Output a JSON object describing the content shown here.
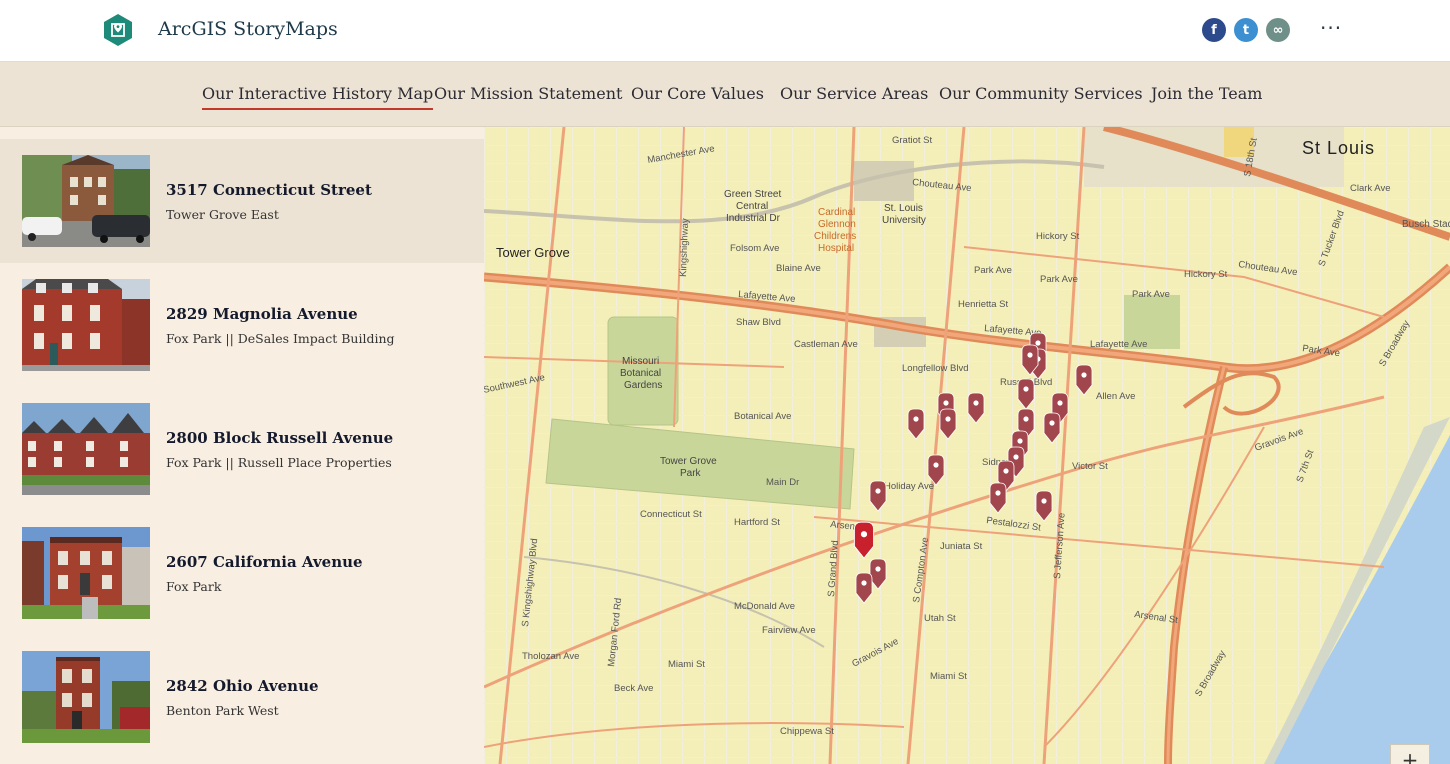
{
  "app": {
    "title": "ArcGIS StoryMaps",
    "brand_color": "#1e8a7a",
    "more_label": "···"
  },
  "share": {
    "facebook_glyph": "f",
    "twitter_glyph": "t",
    "link_glyph": "∞"
  },
  "nav": {
    "items": [
      {
        "label": "Our Interactive History Map",
        "active": true
      },
      {
        "label": "Our Mission Statement",
        "active": false
      },
      {
        "label": "Our Core Values",
        "active": false
      },
      {
        "label": "Our Service Areas",
        "active": false
      },
      {
        "label": "Our Community Services",
        "active": false
      },
      {
        "label": "Join the Team",
        "active": false
      }
    ],
    "active_color": "#c0392b"
  },
  "places": [
    {
      "title": "3517 Connecticut Street",
      "subtitle": "Tower Grove East",
      "selected": true
    },
    {
      "title": "2829 Magnolia Avenue",
      "subtitle": "Fox Park || DeSales Impact Building",
      "selected": false
    },
    {
      "title": "2800 Block Russell Avenue",
      "subtitle": "Fox Park || Russell Place Properties",
      "selected": false
    },
    {
      "title": "2607 California Avenue",
      "subtitle": "Fox Park",
      "selected": false
    },
    {
      "title": "2842 Ohio Avenue",
      "subtitle": "Benton Park West",
      "selected": false
    }
  ],
  "map": {
    "zoom_in_label": "+",
    "marker_color": "#a0464c",
    "active_marker_color": "#c8202c",
    "labels": {
      "st_louis": "St Louis",
      "tower_grove": "Tower Grove",
      "green_street_1": "Green Street",
      "green_street_2": "Central",
      "green_street_3": "Industrial Dr",
      "cardinal_1": "Cardinal",
      "cardinal_2": "Glennon",
      "cardinal_3": "Childrens",
      "cardinal_4": "Hospital",
      "slu_1": "St. Louis",
      "slu_2": "University",
      "botanical_1": "Missouri",
      "botanical_2": "Botanical",
      "botanical_3": "Gardens",
      "tower_grove_park_1": "Tower Grove",
      "tower_grove_park_2": "Park",
      "manchester": "Manchester Ave",
      "chouteau_1": "Chouteau Ave",
      "chouteau_2": "Chouteau Ave",
      "gratiot": "Gratiot St",
      "lafayette_1": "Lafayette Ave",
      "lafayette_2": "Lafayette Ave",
      "lafayette_3": "Lafayette Ave",
      "park_1": "Park Ave",
      "park_2": "Park Ave",
      "park_3": "Park Ave",
      "park_4": "Park Ave",
      "shaw": "Shaw Blvd",
      "castleman": "Castleman Ave",
      "botanical_ave": "Botanical Ave",
      "russell": "Russell Blvd",
      "allen": "Allen Ave",
      "gravois_1": "Gravois Ave",
      "gravois_2": "Gravois Ave",
      "arsenal_1": "Arsenal St",
      "arsenal_2": "Arsenal St",
      "hartford": "Hartford St",
      "connecticut": "Connecticut St",
      "juniata": "Juniata St",
      "utah": "Utah St",
      "miami_1": "Miami St",
      "miami_2": "Miami St",
      "chippewa": "Chippewa St",
      "tholoza": "Tholozan Ave",
      "mcdonald": "McDonald Ave",
      "fairview": "Fairview Ave",
      "beck": "Beck Ave",
      "s_grand": "S Grand Blvd",
      "s_compton": "S Compton Ave",
      "s_jefferson": "S Jefferson Ave",
      "s_kingshighway": "S Kingshighway Blvd",
      "s_tucker": "S Tucker Blvd",
      "s_broadway_1": "S Broadway",
      "s_broadway_2": "S Broadway",
      "s_18th": "S 18th St",
      "s_7th": "S 7th St",
      "morgan_ford": "Morgan Ford Rd",
      "kingshighway_n": "Kingshighway",
      "blaine": "Blaine Ave",
      "folsom": "Folsom Ave",
      "hickory_1": "Hickory St",
      "hickory_2": "Hickory St",
      "henrietta": "Henrietta St",
      "sidney": "Sidney St",
      "victor": "Victor St",
      "pestalozzi": "Pestalozzi St",
      "busch": "Busch Stadiu",
      "clark": "Clark Ave",
      "longfellow": "Longfellow Blvd",
      "holiday": "Holiday Ave",
      "main_dr": "Main Dr",
      "southwest": "Southwest Ave"
    }
  }
}
